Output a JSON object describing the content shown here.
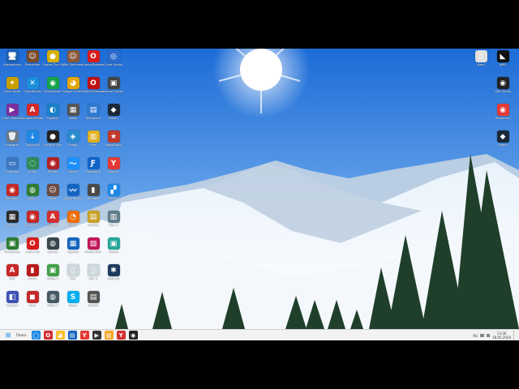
{
  "desktop": {
    "icons": [
      {
        "name": "icon-1",
        "label": "Компьютер",
        "glyph": "🖥",
        "color": "#1f5fb0"
      },
      {
        "name": "icon-2",
        "label": "Fernsehen",
        "glyph": "☺",
        "color": "#7a4a2a"
      },
      {
        "name": "icon-3",
        "label": "Ovotas The Sly",
        "glyph": "●",
        "color": "#d6b000"
      },
      {
        "name": "icon-4",
        "label": "Bild Zeichnen",
        "glyph": "☺",
        "color": "#8a5a3a"
      },
      {
        "name": "icon-5",
        "label": "Opera Browser",
        "glyph": "O",
        "color": "#d91b1b"
      },
      {
        "name": "icon-6",
        "label": "Corel Studio",
        "glyph": "◎",
        "color": "#2a6acc"
      },
      {
        "name": "icon-7",
        "label": "Fonts Node",
        "glyph": "✦",
        "color": "#c7a000"
      },
      {
        "name": "icon-8",
        "label": "CoreUtilities",
        "glyph": "✕",
        "color": "#1c8fdc"
      },
      {
        "name": "icon-9",
        "label": "WinExplorer",
        "glyph": "◉",
        "color": "#16a34a"
      },
      {
        "name": "icon-10",
        "label": "Google Chrome",
        "glyph": "◕",
        "color": "#e4a500"
      },
      {
        "name": "icon-11",
        "label": "Opera Browser",
        "glyph": "O",
        "color": "#c01010"
      },
      {
        "name": "icon-12",
        "label": "Instant Capture",
        "glyph": "▣",
        "color": "#444444"
      },
      {
        "name": "icon-13",
        "label": "Corel VideoStudio",
        "glyph": "▶",
        "color": "#7b2f9e"
      },
      {
        "name": "icon-14",
        "label": "Acrobat Reader",
        "glyph": "A",
        "color": "#d42a2a"
      },
      {
        "name": "icon-15",
        "label": "Capture",
        "glyph": "◐",
        "color": "#1a80c8"
      },
      {
        "name": "icon-16",
        "label": "Media",
        "glyph": "▦",
        "color": "#555555"
      },
      {
        "name": "icon-17",
        "label": "Document",
        "glyph": "▤",
        "color": "#2f7ad1"
      },
      {
        "name": "icon-18",
        "label": "Steam",
        "glyph": "◆",
        "color": "#1b2838"
      },
      {
        "name": "icon-19",
        "label": "Корзина",
        "glyph": "🗑",
        "color": "#6b7c8c"
      },
      {
        "name": "icon-20",
        "label": "Загрузки",
        "glyph": "⇣",
        "color": "#1e88e5"
      },
      {
        "name": "icon-21",
        "label": "Capture One",
        "glyph": "●",
        "color": "#222222"
      },
      {
        "name": "icon-22",
        "label": "Snagit",
        "glyph": "◈",
        "color": "#2a8bd0"
      },
      {
        "name": "icon-23",
        "label": "Files",
        "glyph": "▥",
        "color": "#e0b020"
      },
      {
        "name": "icon-24",
        "label": "MapsEditor",
        "glyph": "★",
        "color": "#c0392b"
      },
      {
        "name": "icon-25",
        "label": "Computer",
        "glyph": "▭",
        "color": "#3b78c2"
      },
      {
        "name": "icon-26",
        "label": "Utility",
        "glyph": "◌",
        "color": "#2e8b57"
      },
      {
        "name": "icon-27",
        "label": "Photos",
        "glyph": "◉",
        "color": "#b22222"
      },
      {
        "name": "icon-28",
        "label": "Wave",
        "glyph": "〜",
        "color": "#1e90ff"
      },
      {
        "name": "icon-29",
        "label": "FastStone",
        "glyph": "Ƒ",
        "color": "#1064c8"
      },
      {
        "name": "icon-30",
        "label": "Яндекс",
        "glyph": "Y",
        "color": "#e53935"
      },
      {
        "name": "icon-31",
        "label": "Recorder",
        "glyph": "◉",
        "color": "#c62828"
      },
      {
        "name": "icon-32",
        "label": "Utility 2",
        "glyph": "◍",
        "color": "#2e7d32"
      },
      {
        "name": "icon-33",
        "label": "Tools",
        "glyph": "☺",
        "color": "#6d4c41"
      },
      {
        "name": "icon-34",
        "label": "Wave Player",
        "glyph": "〰",
        "color": "#1565c0"
      },
      {
        "name": "icon-35",
        "label": "Manager",
        "glyph": "▮",
        "color": "#4a4a4a"
      },
      {
        "name": "icon-36",
        "label": "Blocks",
        "glyph": "▞",
        "color": "#1e88e5"
      },
      {
        "name": "icon-37",
        "label": "Settings",
        "glyph": "▦",
        "color": "#2b2b2b"
      },
      {
        "name": "icon-38",
        "label": "Recorder 2",
        "glyph": "◉",
        "color": "#c62828"
      },
      {
        "name": "icon-39",
        "label": "Acrobat",
        "glyph": "A",
        "color": "#d32f2f"
      },
      {
        "name": "icon-40",
        "label": "Player",
        "glyph": "◔",
        "color": "#ef6c00"
      },
      {
        "name": "icon-41",
        "label": "Archive",
        "glyph": "▤",
        "color": "#c9a227"
      },
      {
        "name": "icon-42",
        "label": "Files 2",
        "glyph": "▥",
        "color": "#607d8b"
      },
      {
        "name": "icon-43",
        "label": "Photoshop",
        "glyph": "▣",
        "color": "#2e7d32"
      },
      {
        "name": "icon-44",
        "label": "Opera GX",
        "glyph": "O",
        "color": "#d81b1b"
      },
      {
        "name": "icon-45",
        "label": "Games",
        "glyph": "◍",
        "color": "#37474f"
      },
      {
        "name": "icon-46",
        "label": "Reports",
        "glyph": "▦",
        "color": "#1565c0"
      },
      {
        "name": "icon-47",
        "label": "Media Pack",
        "glyph": "▨",
        "color": "#c2185b"
      },
      {
        "name": "icon-48",
        "label": "Viewer",
        "glyph": "▣",
        "color": "#26a69a"
      },
      {
        "name": "icon-49",
        "label": "PDF",
        "glyph": "A",
        "color": "#c62828"
      },
      {
        "name": "icon-50",
        "label": "Audio",
        "glyph": "▮",
        "color": "#b71c1c"
      },
      {
        "name": "icon-51",
        "label": "Utility 3",
        "glyph": "▣",
        "color": "#43a047"
      },
      {
        "name": "icon-52",
        "label": "Doc",
        "glyph": "▯",
        "color": "#cfd8dc"
      },
      {
        "name": "icon-53",
        "label": "Doc 2",
        "glyph": "▯",
        "color": "#cfd8dc"
      },
      {
        "name": "icon-54",
        "label": "Settings",
        "glyph": "✱",
        "color": "#1e3a5f"
      },
      {
        "name": "icon-55",
        "label": "Capture",
        "glyph": "◧",
        "color": "#3f51b5"
      },
      {
        "name": "icon-56",
        "label": "Nero",
        "glyph": "◼",
        "color": "#c62828"
      },
      {
        "name": "icon-57",
        "label": "Utility 4",
        "glyph": "◍",
        "color": "#455a64"
      },
      {
        "name": "icon-58",
        "label": "Skype",
        "glyph": "S",
        "color": "#00aff0"
      },
      {
        "name": "icon-59",
        "label": "Recent",
        "glyph": "▤",
        "color": "#555555"
      },
      {
        "name": "icon-60",
        "label": "AMD",
        "glyph": "◣",
        "color": "#111111"
      },
      {
        "name": "icon-61",
        "label": "OBS Studio",
        "glyph": "◉",
        "color": "#222222"
      },
      {
        "name": "icon-62",
        "label": "Bandicam",
        "glyph": "◉",
        "color": "#e53935"
      },
      {
        "name": "icon-63",
        "label": "Steam",
        "glyph": "◆",
        "color": "#1b2838"
      },
      {
        "name": "icon-64",
        "label": "Word",
        "glyph": "▯",
        "color": "#e0e0e0"
      }
    ]
  },
  "taskbar": {
    "start_label": "⊞",
    "search_label": "Поиск",
    "apps": [
      {
        "name": "taskbar-cortana",
        "glyph": "◯",
        "color": "#1e88e5"
      },
      {
        "name": "taskbar-opera",
        "glyph": "O",
        "color": "#d32f2f"
      },
      {
        "name": "taskbar-chrome",
        "glyph": "◕",
        "color": "#fbc02d"
      },
      {
        "name": "taskbar-store",
        "glyph": "▤",
        "color": "#1565c0"
      },
      {
        "name": "taskbar-yandex",
        "glyph": "Y",
        "color": "#e53935"
      },
      {
        "name": "taskbar-media",
        "glyph": "▶",
        "color": "#333333"
      },
      {
        "name": "taskbar-explorer",
        "glyph": "▥",
        "color": "#f9a825"
      },
      {
        "name": "taskbar-ybrowser",
        "glyph": "Y",
        "color": "#d32f2f"
      },
      {
        "name": "taskbar-obs",
        "glyph": "◉",
        "color": "#222222"
      }
    ],
    "tray_lang": "RU",
    "clock_time": "13:30",
    "clock_date": "18.05.2020"
  }
}
